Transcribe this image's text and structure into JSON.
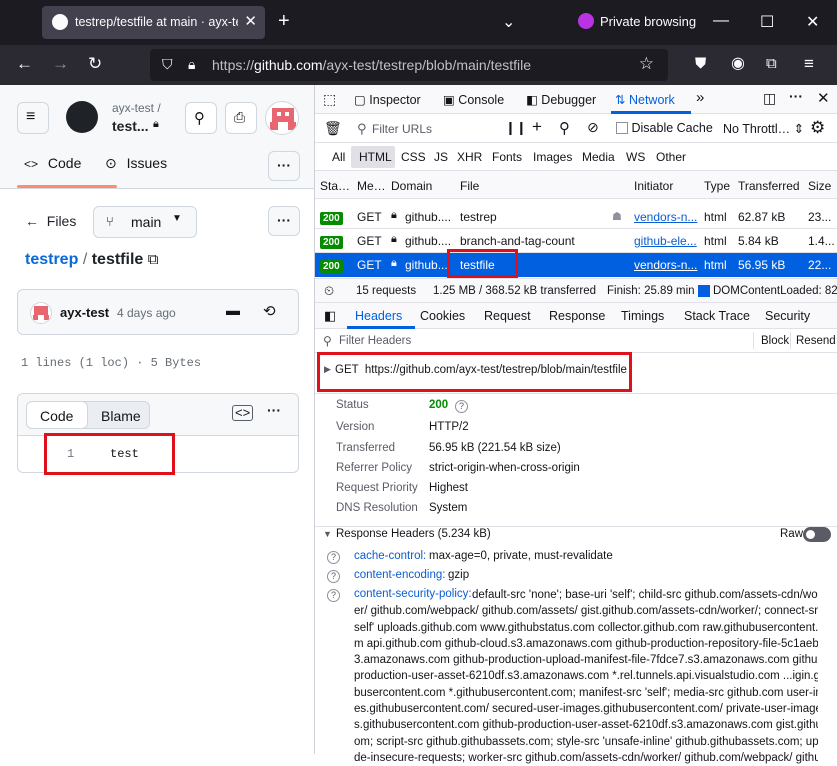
{
  "browser": {
    "tab_title": "testrep/testfile at main · ayx-test",
    "private_label": "Private browsing",
    "url": "https://github.com/ayx-test/testrep/blob/main/testfile",
    "url_host": "github.com",
    "url_path": "/ayx-test/testrep/blob/main/testfile"
  },
  "github": {
    "owner": "ayx-test /",
    "repo": "test...",
    "tabs": [
      "Code",
      "Issues"
    ],
    "files_label": "Files",
    "branch": "main",
    "breadcrumb_repo": "testrep",
    "breadcrumb_sep": "/",
    "breadcrumb_file": "testfile",
    "commit_author": "ayx-test",
    "commit_time": "4 days ago",
    "file_info": "1 lines (1 loc) · 5 Bytes",
    "view_code": "Code",
    "view_blame": "Blame",
    "line_number": "1",
    "line_text": "test"
  },
  "devtools": {
    "tools": [
      "Inspector",
      "Console",
      "Debugger",
      "Network"
    ],
    "filter_placeholder": "Filter URLs",
    "disable_cache": "Disable Cache",
    "throttle": "No Throttl…",
    "types": [
      "All",
      "HTML",
      "CSS",
      "JS",
      "XHR",
      "Fonts",
      "Images",
      "Media",
      "WS",
      "Other"
    ],
    "columns": [
      "Sta…",
      "Me…",
      "Domain",
      "File",
      "Initiator",
      "Type",
      "Transferred",
      "Size"
    ],
    "requests": [
      {
        "status": "200",
        "method": "GET",
        "domain": "github....",
        "file": "testrep",
        "initiator": "vendors-n...",
        "type": "html",
        "transferred": "62.87 kB",
        "size": "23..."
      },
      {
        "status": "200",
        "method": "GET",
        "domain": "github....",
        "file": "branch-and-tag-count",
        "initiator": "github-ele...",
        "type": "html",
        "transferred": "5.84 kB",
        "size": "1.4..."
      },
      {
        "status": "200",
        "method": "GET",
        "domain": "github....",
        "file": "testfile",
        "initiator": "vendors-n...",
        "type": "html",
        "transferred": "56.95 kB",
        "size": "22..."
      }
    ],
    "summary": {
      "requests": "15 requests",
      "transferred": "1.25 MB / 368.52 kB transferred",
      "finish": "Finish: 25.89 min",
      "dcl": "DOMContentLoaded: 82..."
    },
    "detail_tabs": [
      "Headers",
      "Cookies",
      "Request",
      "Response",
      "Timings",
      "Stack Trace",
      "Security"
    ],
    "filter_headers": "Filter Headers",
    "block": "Block",
    "resend": "Resend",
    "request_line": "GET  https://github.com/ayx-test/testrep/blob/main/testfile",
    "general": [
      {
        "k": "Status",
        "v": "200"
      },
      {
        "k": "Version",
        "v": "HTTP/2"
      },
      {
        "k": "Transferred",
        "v": "56.95 kB (221.54 kB size)"
      },
      {
        "k": "Referrer Policy",
        "v": "strict-origin-when-cross-origin"
      },
      {
        "k": "Request Priority",
        "v": "Highest"
      },
      {
        "k": "DNS Resolution",
        "v": "System"
      }
    ],
    "response_headers_title": "Response Headers (5.234 kB)",
    "raw": "Raw",
    "response_headers": [
      {
        "k": "cache-control:",
        "v": "max-age=0, private, must-revalidate"
      },
      {
        "k": "content-encoding:",
        "v": "gzip"
      },
      {
        "k": "content-security-policy:",
        "v": "default-src 'none'; base-uri 'self'; child-src"
      }
    ],
    "csp_lines": [
      "default-src 'none'; base-uri 'self'; child-src github.com/assets-cdn/work",
      "er/ github.com/webpack/ github.com/assets/ gist.github.com/assets-cdn/worker/; connect-src '",
      "self' uploads.github.com www.githubstatus.com collector.github.com raw.githubusercontent.co",
      "m api.github.com github-cloud.s3.amazonaws.com github-production-repository-file-5c1aeb.s",
      "3.amazonaws.com github-production-upload-manifest-file-7fdce7.s3.amazonaws.com github-",
      "production-user-asset-6210df.s3.amazonaws.com *.rel.tunnels.api.visualstudio.com ...igin.githu",
      "busercontent.com *.githubusercontent.com; manifest-src 'self'; media-src github.com user-imag",
      "es.githubusercontent.com/ secured-user-images.githubusercontent.com/ private-user-image",
      "s.githubusercontent.com github-production-user-asset-6210df.s3.amazonaws.com gist.github.c",
      "om; script-src github.githubassets.com; style-src 'unsafe-inline' github.githubassets.com; upgra",
      "de-insecure-requests; worker-src github.com/assets-cdn/worker/ github.com/webpack/ githu"
    ]
  },
  "colors": {
    "accent_blue": "#0060df",
    "github_link": "#0969da",
    "highlight": "#e0101a",
    "status_green": "#058b00"
  }
}
